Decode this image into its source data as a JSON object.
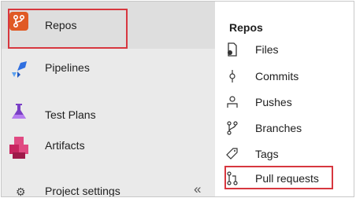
{
  "nav": {
    "items": [
      {
        "label": "Repos",
        "icon": "repos-icon"
      },
      {
        "label": "Pipelines",
        "icon": "pipelines-icon"
      },
      {
        "label": "Test Plans",
        "icon": "test-plans-icon"
      },
      {
        "label": "Artifacts",
        "icon": "artifacts-icon"
      }
    ],
    "settings_label": "Project settings",
    "collapse_glyph": "«"
  },
  "submenu": {
    "title": "Repos",
    "items": [
      {
        "label": "Files",
        "icon": "files-icon"
      },
      {
        "label": "Commits",
        "icon": "commit-icon"
      },
      {
        "label": "Pushes",
        "icon": "push-icon"
      },
      {
        "label": "Branches",
        "icon": "branch-icon"
      },
      {
        "label": "Tags",
        "icon": "tag-icon"
      },
      {
        "label": "Pull requests",
        "icon": "pull-request-icon"
      }
    ]
  },
  "colors": {
    "highlight_border": "#d7373f",
    "repos_accent": "#e05a24",
    "pipelines_accent": "#2f6fe0",
    "testplans_accent": "#7a3fc6",
    "artifacts_accent": "#c7245f"
  }
}
